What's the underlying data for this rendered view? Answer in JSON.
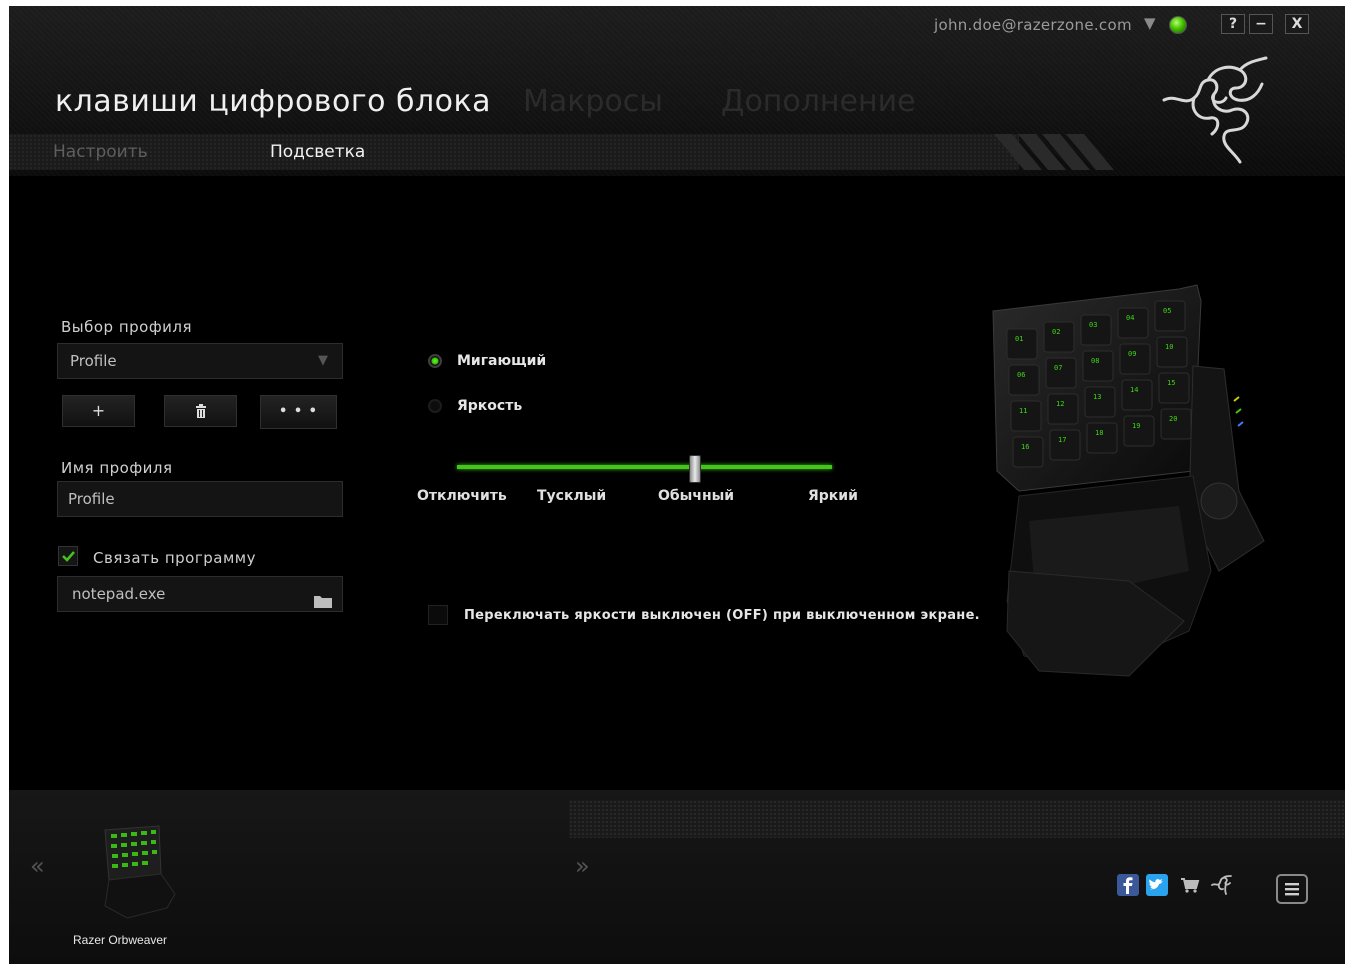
{
  "header": {
    "account_email": "john.doe@razerzone.com",
    "status_color": "#44c000",
    "window_buttons": [
      "?",
      "−",
      "X"
    ],
    "title": "клавиши цифрового блока",
    "tabs": [
      "Макросы",
      "Дополнение"
    ],
    "subtabs": [
      "Настроить",
      "Подсветка"
    ],
    "active_subtab": "Подсветка"
  },
  "profile": {
    "select_label": "Выбор профиля",
    "selected": "Profile",
    "buttons": [
      "+",
      "🗑",
      "• • •"
    ],
    "name_label": "Имя профиля",
    "name_value": "Profile",
    "link_label": "Связать программу",
    "link_checked": true,
    "program": "notepad.exe"
  },
  "lighting": {
    "options": [
      "Мигающий",
      "Яркость"
    ],
    "selected_option": "Мигающий",
    "brightness_levels": [
      "Отключить",
      "Тусклый",
      "Обычный",
      "Яркий"
    ],
    "brightness_value": "Обычный",
    "screen_off_label": "Переключать яркости выключен (OFF) при выключенном экране.",
    "screen_off_checked": false,
    "accent_color": "#44c51a"
  },
  "keypad": {
    "keys": [
      "01",
      "02",
      "03",
      "04",
      "05",
      "06",
      "07",
      "08",
      "09",
      "10",
      "11",
      "12",
      "13",
      "14",
      "15",
      "16",
      "17",
      "18",
      "19",
      "20"
    ]
  },
  "footer": {
    "device_name": "Razer Orbweaver",
    "prev_arrow": "«",
    "next_arrow": "»",
    "icons": [
      "facebook-icon",
      "twitter-icon",
      "cart-icon",
      "razer-icon",
      "menu-icon"
    ]
  }
}
